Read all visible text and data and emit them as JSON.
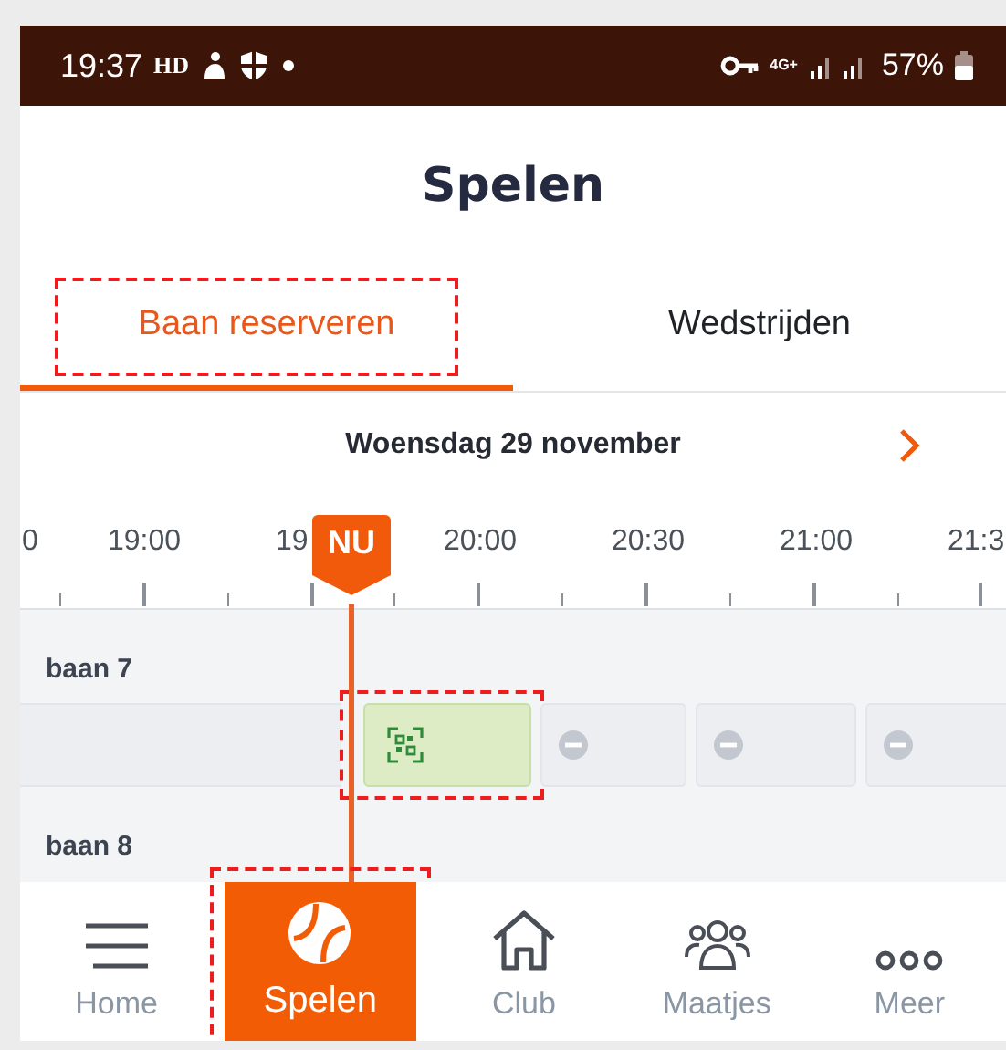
{
  "status_bar": {
    "time": "19:37",
    "hd": "HD",
    "network": "4G+",
    "battery": "57%"
  },
  "header": {
    "title": "Spelen"
  },
  "tabs": [
    {
      "label": "Baan reserveren",
      "selected": true,
      "highlighted": true
    },
    {
      "label": "Wedstrijden",
      "selected": false,
      "highlighted": false
    }
  ],
  "date": {
    "label": "Woensdag 29 november"
  },
  "timeline": {
    "labels": [
      "0",
      "19:00",
      "19",
      "20:00",
      "20:30",
      "21:00",
      "21:3"
    ],
    "now_label": "NU"
  },
  "courts": [
    {
      "name": "baan 7",
      "slots": [
        {
          "kind": "empty",
          "highlighted": false
        },
        {
          "kind": "available",
          "highlighted": true
        },
        {
          "kind": "blocked",
          "highlighted": false
        },
        {
          "kind": "blocked",
          "highlighted": false
        },
        {
          "kind": "blocked",
          "highlighted": false
        }
      ]
    },
    {
      "name": "baan 8"
    }
  ],
  "nav": [
    {
      "label": "Home",
      "selected": false,
      "highlighted": false
    },
    {
      "label": "Spelen",
      "selected": true,
      "highlighted": true
    },
    {
      "label": "Club",
      "selected": false,
      "highlighted": false
    },
    {
      "label": "Maatjes",
      "selected": false,
      "highlighted": false
    },
    {
      "label": "Meer",
      "selected": false,
      "highlighted": false
    }
  ]
}
